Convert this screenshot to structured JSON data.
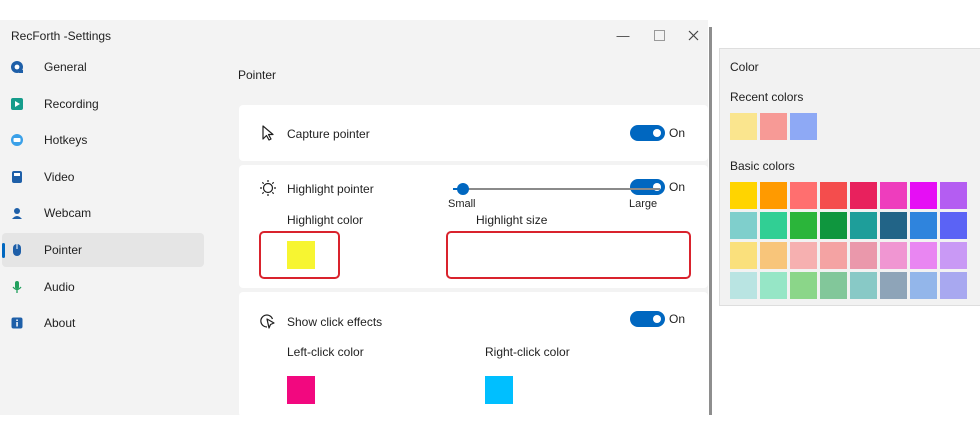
{
  "window": {
    "title": "RecForth -Settings",
    "min_glyph": "—",
    "max_glyph": "☐",
    "close_glyph": "✕"
  },
  "sidebar": {
    "items": [
      {
        "label": "General",
        "icon": "gear-icon",
        "active": false
      },
      {
        "label": "Recording",
        "icon": "recording-icon",
        "active": false
      },
      {
        "label": "Hotkeys",
        "icon": "keyboard-icon",
        "active": false
      },
      {
        "label": "Video",
        "icon": "video-icon",
        "active": false
      },
      {
        "label": "Webcam",
        "icon": "webcam-icon",
        "active": false
      },
      {
        "label": "Pointer",
        "icon": "mouse-icon",
        "active": true
      },
      {
        "label": "Audio",
        "icon": "microphone-icon",
        "active": false
      },
      {
        "label": "About",
        "icon": "info-icon",
        "active": false
      }
    ]
  },
  "pointer": {
    "page_title": "Pointer",
    "capture": {
      "label": "Capture pointer",
      "toggle_label": "On",
      "icon": "cursor-arrow-icon"
    },
    "highlight": {
      "label": "Highlight pointer",
      "toggle_label": "On",
      "icon": "sun-icon",
      "color_label": "Highlight color",
      "color": "#f7f531",
      "size_label": "Highlight size",
      "size_min": "Small",
      "size_max": "Large",
      "size_value": 0.05
    },
    "click_effects": {
      "label": "Show click effects",
      "toggle_label": "On",
      "icon": "click-cursor-icon",
      "left_label": "Left-click color",
      "left_color": "#f2087f",
      "right_label": "Right-click color",
      "right_color": "#00bfff"
    }
  },
  "color_panel": {
    "title": "Color",
    "recent_label": "Recent colors",
    "recent": [
      "#fae58e",
      "#f79a96",
      "#8ea9f5"
    ],
    "basic_label": "Basic colors",
    "basic": [
      [
        "#ffd400",
        "#ff9a00",
        "#ff6f6f",
        "#f44d4d",
        "#e8215d",
        "#ee3dbd",
        "#e60ef5",
        "#b45df2"
      ],
      [
        "#7fcfcc",
        "#31cf94",
        "#2bb53a",
        "#0f963e",
        "#1e9e9a",
        "#226487",
        "#2f84dd",
        "#5b63f5"
      ],
      [
        "#fae07c",
        "#f8c57a",
        "#f6b0b0",
        "#f4a3a3",
        "#ea98ab",
        "#f096d2",
        "#e986f2",
        "#c999f5"
      ],
      [
        "#b9e4e2",
        "#96e6c6",
        "#8bd689",
        "#82c79a",
        "#88c9c6",
        "#8ea4b8",
        "#93b6ea",
        "#a8a8f0"
      ]
    ]
  },
  "colors": {
    "accent": "#0067c0",
    "annotation": "#d9232d"
  }
}
